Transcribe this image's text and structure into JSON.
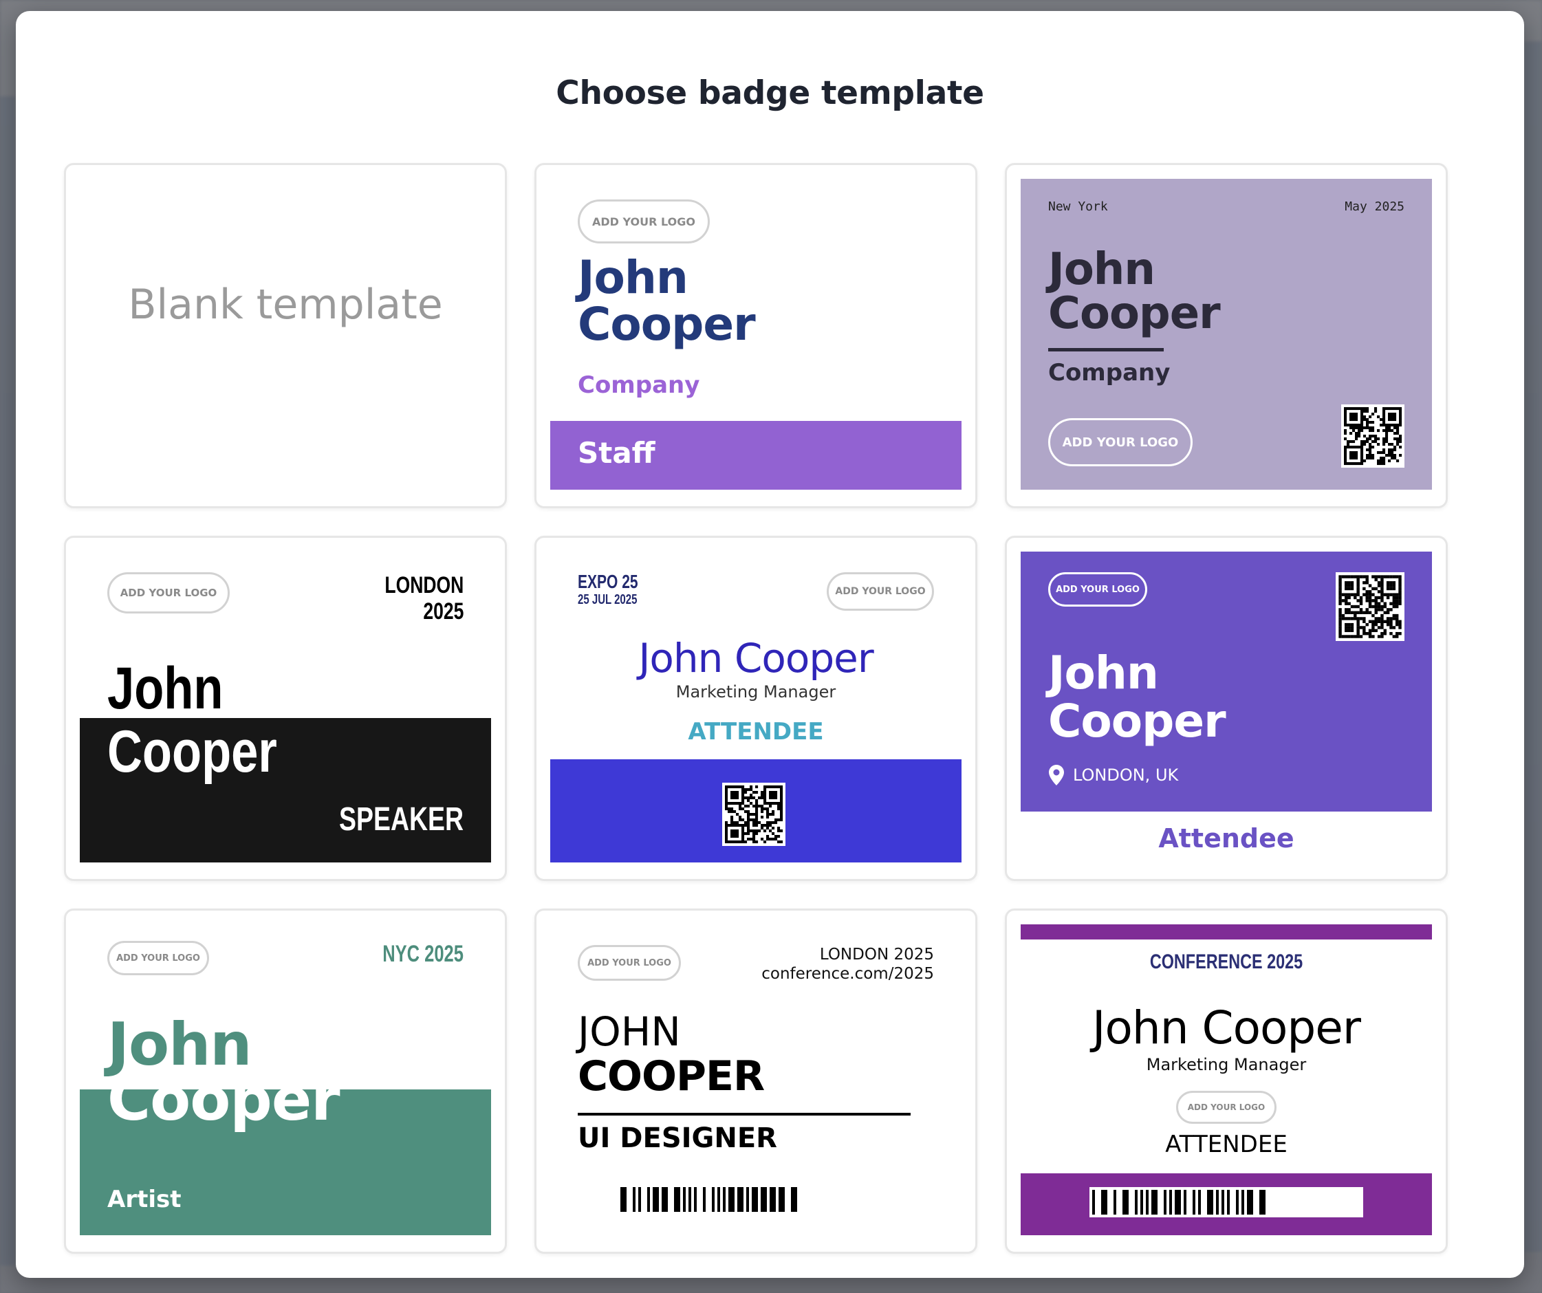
{
  "modal": {
    "title": "Choose badge template"
  },
  "logo_pill": "ADD YOUR LOGO",
  "templates": {
    "blank": {
      "label": "Blank template"
    },
    "staff": {
      "first": "John",
      "last": "Cooper",
      "company": "Company",
      "role": "Staff"
    },
    "lavender": {
      "city": "New York",
      "date": "May 2025",
      "first": "John",
      "last": "Cooper",
      "company": "Company"
    },
    "speaker": {
      "event_line1": "LONDON",
      "event_line2": "2025",
      "first": "John",
      "last": "Cooper",
      "role": "SPEAKER"
    },
    "expo": {
      "event": "EXPO 25",
      "date": "25 JUL 2025",
      "name": "John Cooper",
      "title": "Marketing Manager",
      "role": "ATTENDEE"
    },
    "purple_attendee": {
      "first": "John",
      "last": "Cooper",
      "location": "LONDON, UK",
      "role": "Attendee"
    },
    "artist": {
      "event": "NYC 2025",
      "first": "John",
      "last": "Cooper",
      "role": "Artist"
    },
    "designer": {
      "event_line1": "LONDON 2025",
      "event_line2": "conference.com/2025",
      "first": "JOHN",
      "last": "COOPER",
      "role": "UI DESIGNER"
    },
    "conference": {
      "event": "CONFERENCE 2025",
      "name": "John Cooper",
      "title": "Marketing Manager",
      "role": "ATTENDEE"
    }
  },
  "colors": {
    "staff_accent": "#9262d2",
    "lavender_bg": "#b0a6c8",
    "expo_strip": "#3e39d6",
    "purple_attendee": "#6a52c4",
    "artist_green": "#4f8f7e",
    "conference_purple": "#7f2c96"
  },
  "icons": {
    "location": "map-pin-icon",
    "qr": "qr-code-icon",
    "barcode": "barcode-icon"
  }
}
